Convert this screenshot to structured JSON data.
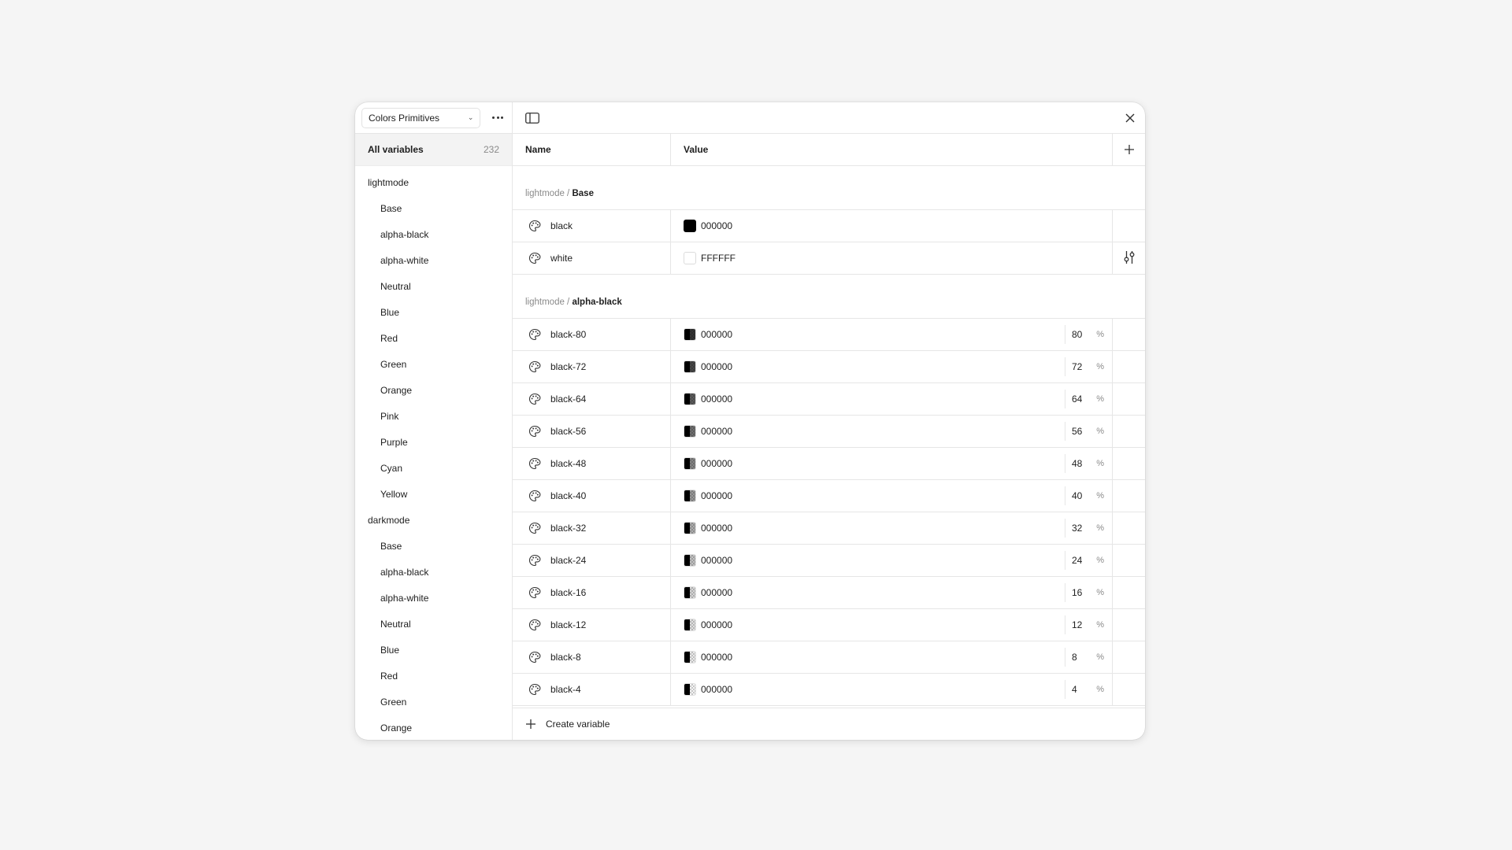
{
  "sidebar": {
    "collection": "Colors Primitives",
    "all_label": "All variables",
    "all_count": "232",
    "groups": [
      {
        "label": "lightmode",
        "items": [
          "Base",
          "alpha-black",
          "alpha-white",
          "Neutral",
          "Blue",
          "Red",
          "Green",
          "Orange",
          "Pink",
          "Purple",
          "Cyan",
          "Yellow"
        ]
      },
      {
        "label": "darkmode",
        "items": [
          "Base",
          "alpha-black",
          "alpha-white",
          "Neutral",
          "Blue",
          "Red",
          "Green",
          "Orange"
        ]
      }
    ]
  },
  "table": {
    "headers": {
      "name": "Name",
      "value": "Value"
    },
    "sections": [
      {
        "crumb": "lightmode /",
        "leaf": "Base",
        "rows": [
          {
            "name": "black",
            "hex": "000000",
            "swatch": "solid-black"
          },
          {
            "name": "white",
            "hex": "FFFFFF",
            "swatch": "solid-white",
            "extra_icon": "adjust-icon"
          }
        ]
      },
      {
        "crumb": "lightmode /",
        "leaf": "alpha-black",
        "rows": [
          {
            "name": "black-80",
            "hex": "000000",
            "opacity": "80",
            "alpha": 0.8
          },
          {
            "name": "black-72",
            "hex": "000000",
            "opacity": "72",
            "alpha": 0.72
          },
          {
            "name": "black-64",
            "hex": "000000",
            "opacity": "64",
            "alpha": 0.64
          },
          {
            "name": "black-56",
            "hex": "000000",
            "opacity": "56",
            "alpha": 0.56
          },
          {
            "name": "black-48",
            "hex": "000000",
            "opacity": "48",
            "alpha": 0.48
          },
          {
            "name": "black-40",
            "hex": "000000",
            "opacity": "40",
            "alpha": 0.4
          },
          {
            "name": "black-32",
            "hex": "000000",
            "opacity": "32",
            "alpha": 0.32
          },
          {
            "name": "black-24",
            "hex": "000000",
            "opacity": "24",
            "alpha": 0.24
          },
          {
            "name": "black-16",
            "hex": "000000",
            "opacity": "16",
            "alpha": 0.16
          },
          {
            "name": "black-12",
            "hex": "000000",
            "opacity": "12",
            "alpha": 0.12
          },
          {
            "name": "black-8",
            "hex": "000000",
            "opacity": "8",
            "alpha": 0.08
          },
          {
            "name": "black-4",
            "hex": "000000",
            "opacity": "4",
            "alpha": 0.04
          }
        ]
      }
    ],
    "percent_sign": "%",
    "create_label": "Create variable"
  }
}
